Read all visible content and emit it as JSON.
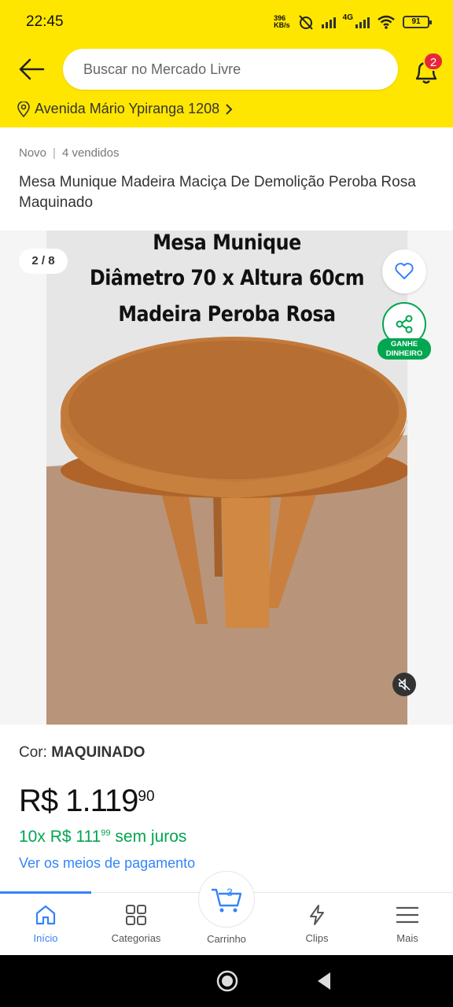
{
  "status_bar": {
    "time": "22:45",
    "net_speed_value": "396",
    "net_speed_unit": "KB/s",
    "network": "4G",
    "battery": "91"
  },
  "header": {
    "search_placeholder": "Buscar no Mercado Livre",
    "notification_count": "2",
    "address": "Avenida Mário Ypiranga 1208",
    "accent_color": "#ffe600"
  },
  "product": {
    "condition": "Novo",
    "sold": "4 vendidos",
    "title": "Mesa Munique Madeira Maciça De Demolição Peroba Rosa Maquinado",
    "gallery_counter": "2 / 8",
    "image_text": [
      "Mesa Munique",
      "Diâmetro 70 x Altura 60cm",
      "Madeira Peroba Rosa"
    ],
    "share_badge_line1": "GANHE",
    "share_badge_line2": "DINHEIRO",
    "color_label": "Cor:",
    "color_value": "MAQUINADO",
    "price_main": "R$ 1.119",
    "price_cents": "90",
    "installments_prefix": "10x R$ 111",
    "installments_cents": "99",
    "installments_suffix": "sem juros",
    "payment_link": "Ver os meios de pagamento"
  },
  "tabbar": {
    "items": [
      {
        "label": "Início",
        "icon": "home-icon",
        "active": true
      },
      {
        "label": "Categorias",
        "icon": "grid-icon",
        "active": false
      },
      {
        "label": "Carrinho",
        "icon": "cart-icon",
        "active": false
      },
      {
        "label": "Clips",
        "icon": "clips-icon",
        "active": false
      },
      {
        "label": "Mais",
        "icon": "menu-icon",
        "active": false
      }
    ],
    "cart_count": "3",
    "active_color": "#3483fa"
  }
}
